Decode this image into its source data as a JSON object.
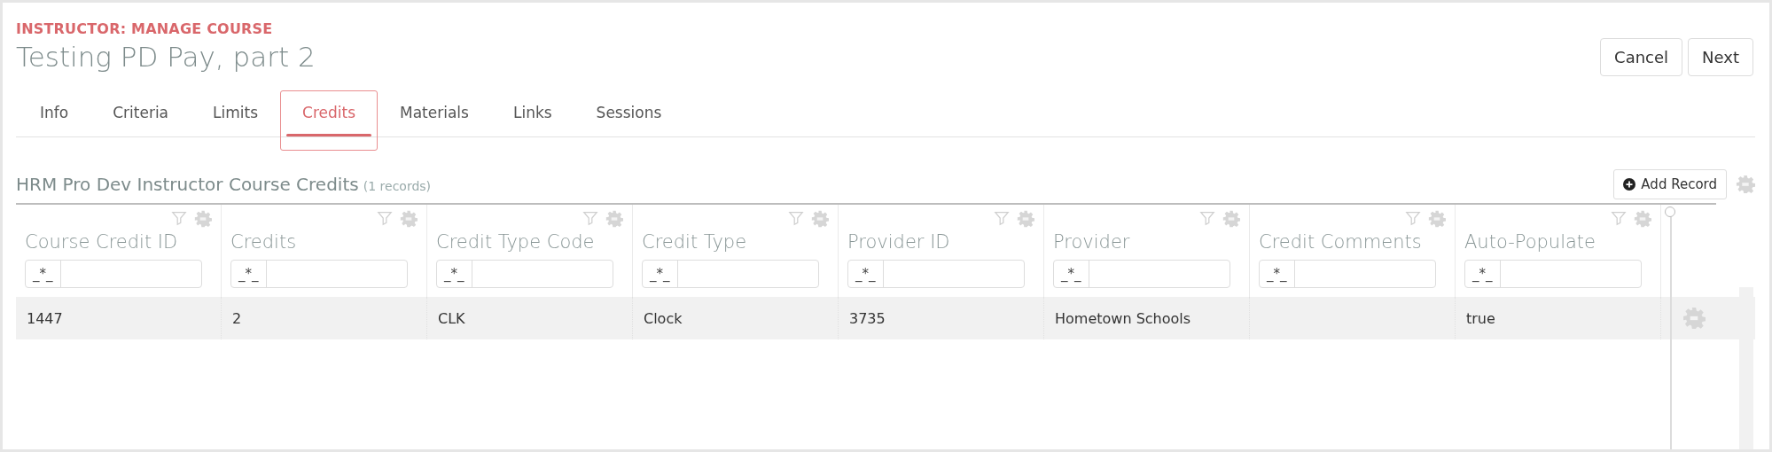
{
  "header": {
    "eyebrow": "INSTRUCTOR: MANAGE COURSE",
    "title": "Testing PD Pay, part 2"
  },
  "actions": [
    "Cancel",
    "Next"
  ],
  "tabs": [
    {
      "label": "Info",
      "selected": false
    },
    {
      "label": "Criteria",
      "selected": false
    },
    {
      "label": "Limits",
      "selected": false
    },
    {
      "label": "Credits",
      "selected": true
    },
    {
      "label": "Materials",
      "selected": false
    },
    {
      "label": "Links",
      "selected": false
    },
    {
      "label": "Sessions",
      "selected": false
    }
  ],
  "grid": {
    "title": "HRM Pro Dev Instructor Course Credits",
    "count": "(1 records)",
    "add_button": "Add Record",
    "columns": [
      {
        "label": "Course Credit ID",
        "filter_prefix": "_*_"
      },
      {
        "label": "Credits",
        "filter_prefix": "_*_"
      },
      {
        "label": "Credit Type Code",
        "filter_prefix": "_*_"
      },
      {
        "label": "Credit Type",
        "filter_prefix": "_*_"
      },
      {
        "label": "Provider ID",
        "filter_prefix": "_*_"
      },
      {
        "label": "Provider",
        "filter_prefix": "_*_"
      },
      {
        "label": "Credit Comments",
        "filter_prefix": "_*_"
      },
      {
        "label": "Auto-Populate",
        "filter_prefix": "_*_"
      }
    ],
    "rows": [
      {
        "cells": [
          "1447",
          "2",
          "CLK",
          "Clock",
          "3735",
          "Hometown Schools",
          "",
          "true"
        ]
      }
    ]
  }
}
